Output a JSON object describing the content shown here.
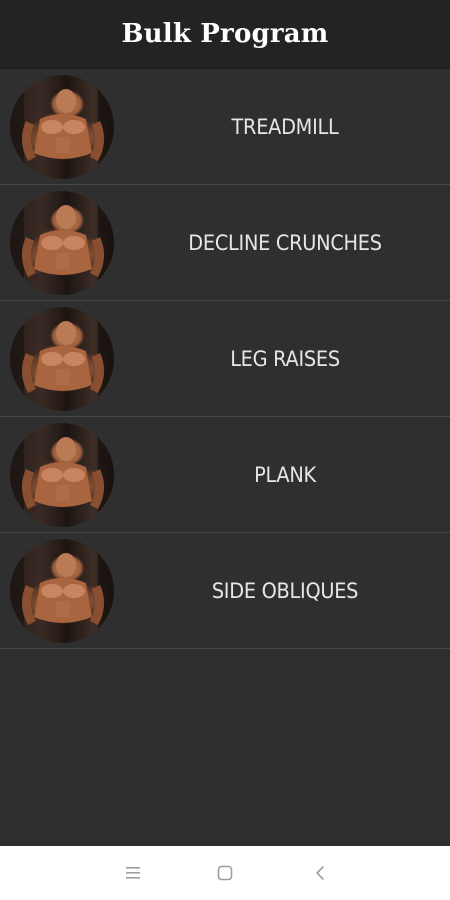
{
  "header": {
    "title": "Bulk Program"
  },
  "exercises": [
    {
      "label": "TREADMILL"
    },
    {
      "label": "DECLINE CRUNCHES"
    },
    {
      "label": "LEG RAISES"
    },
    {
      "label": "PLANK"
    },
    {
      "label": "SIDE OBLIQUES"
    }
  ],
  "navbar": {
    "buttons": [
      "menu-icon",
      "home-square-icon",
      "back-chevron-icon"
    ]
  },
  "colors": {
    "header_bg": "#232323",
    "list_bg": "#2f2f2f",
    "divider": "#474747",
    "label_text": "#e6e6e6",
    "navbar_bg": "#ffffff",
    "nav_icon": "#9e9e9e"
  }
}
